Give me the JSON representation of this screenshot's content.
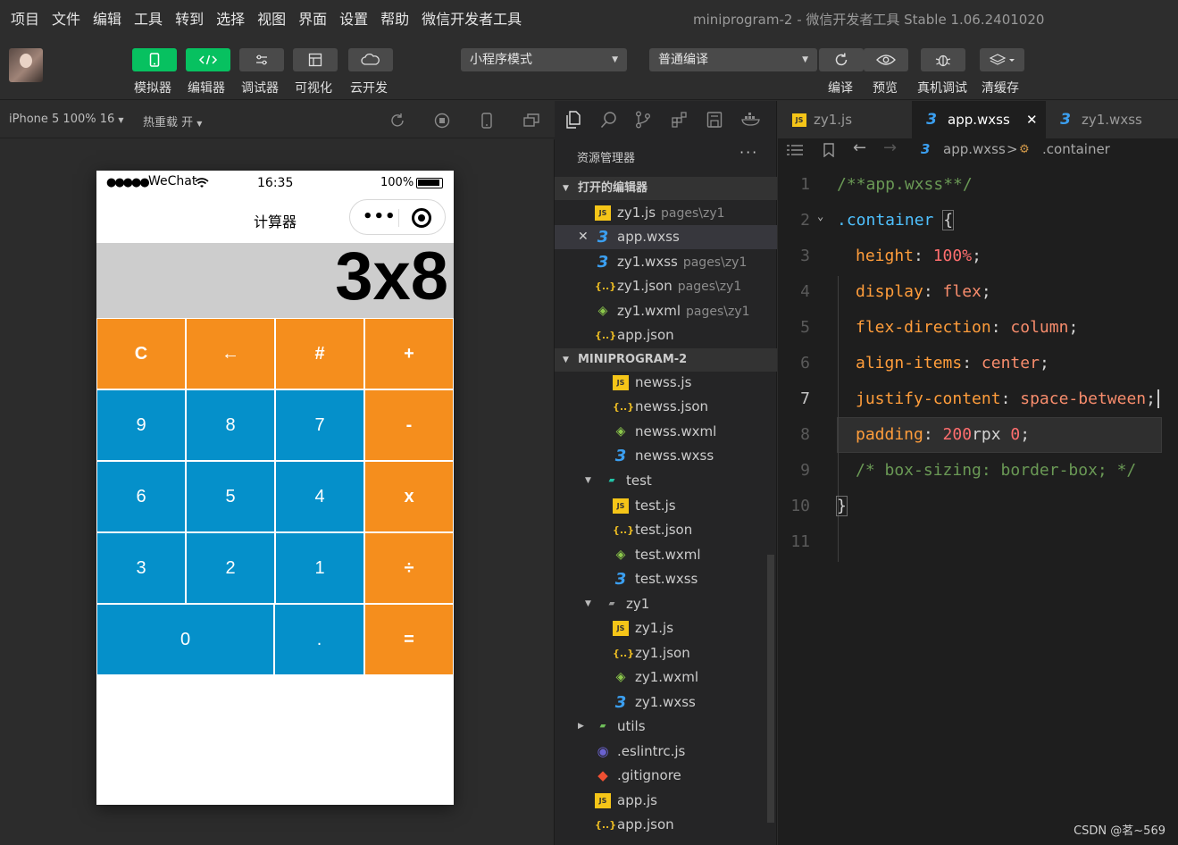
{
  "menu": [
    "项目",
    "文件",
    "编辑",
    "工具",
    "转到",
    "选择",
    "视图",
    "界面",
    "设置",
    "帮助",
    "微信开发者工具"
  ],
  "window_title": "miniprogram-2 - 微信开发者工具 Stable 1.06.2401020",
  "toolbar": {
    "simulator": "模拟器",
    "editor": "编辑器",
    "debugger": "调试器",
    "visual": "可视化",
    "cloud": "云开发",
    "mode_select": "小程序模式",
    "compile_select": "普通编译",
    "compile": "编译",
    "preview": "预览",
    "device_debug": "真机调试",
    "clear_cache": "清缓存"
  },
  "simulator_bar": {
    "device": "iPhone 5 100% 16",
    "hot_reload": "热重载 开"
  },
  "phone": {
    "signal": "●●●●●",
    "carrier": "WeChat",
    "time": "16:35",
    "battery": "100%",
    "page_title": "计算器",
    "capsule_more": "•••",
    "display": "3x8",
    "keys": {
      "k_c": "C",
      "k_back": "←",
      "k_hash": "#",
      "k_plus": "+",
      "k9": "9",
      "k8": "8",
      "k7": "7",
      "k_minus": "-",
      "k6": "6",
      "k5": "5",
      "k4": "4",
      "k_times": "x",
      "k3": "3",
      "k2": "2",
      "k1": "1",
      "k_div": "÷",
      "k0": "0",
      "k_dot": ".",
      "k_eq": "="
    }
  },
  "explorer": {
    "title": "资源管理器",
    "more": "···",
    "open_editors": "打开的编辑器",
    "open_files": [
      {
        "name": "zy1.js",
        "path": "pages\\zy1"
      },
      {
        "name": "app.wxss",
        "path": ""
      },
      {
        "name": "zy1.wxss",
        "path": "pages\\zy1"
      },
      {
        "name": "zy1.json",
        "path": "pages\\zy1"
      },
      {
        "name": "zy1.wxml",
        "path": "pages\\zy1"
      },
      {
        "name": "app.json",
        "path": ""
      }
    ],
    "project": "MINIPROGRAM-2",
    "tree": [
      "newss.js",
      "newss.json",
      "newss.wxml",
      "newss.wxss",
      "test",
      "test.js",
      "test.json",
      "test.wxml",
      "test.wxss",
      "zy1",
      "zy1.js",
      "zy1.json",
      "zy1.wxml",
      "zy1.wxss",
      "utils",
      ".eslintrc.js",
      ".gitignore",
      "app.js",
      "app.json"
    ]
  },
  "editor": {
    "tabs": [
      "zy1.js",
      "app.wxss",
      "zy1.wxss"
    ],
    "breadcrumb_file": "app.wxss",
    "breadcrumb_sep": ">",
    "breadcrumb_symbol": ".container",
    "line_numbers": [
      "1",
      "2",
      "3",
      "4",
      "5",
      "6",
      "7",
      "8",
      "9",
      "10",
      "11"
    ],
    "code": {
      "l1": "/**app.wxss**/",
      "l2_sel": ".container",
      "l2_brace": "{",
      "l3_prop": "height",
      "l3_val": "100%",
      "l4_prop": "display",
      "l4_val": "flex",
      "l5_prop": "flex-direction",
      "l5_val": "column",
      "l6_prop": "align-items",
      "l6_val": "center",
      "l7_prop": "justify-content",
      "l7_val": "space-between",
      "l8_prop": "padding",
      "l8_num": "200",
      "l8_unit": "rpx",
      "l8_zero": "0",
      "l9": "/* box-sizing: border-box; */",
      "l10": "}"
    }
  },
  "watermark": "CSDN @茗~569",
  "colors": {
    "accent_green": "#07c160",
    "calc_orange": "#f58e1d",
    "calc_blue": "#0590ca",
    "display_gray": "#cdcdcd"
  }
}
